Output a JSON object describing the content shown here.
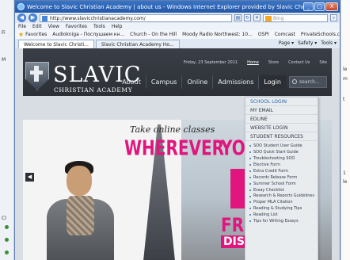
{
  "window": {
    "title": "Welcome to Slavic Christian Academy | about us - Windows Internet Explorer provided by Slavic Christian Academy",
    "min": "_",
    "max": "□",
    "close": "X"
  },
  "addressbar": {
    "url": "http://www.slavicchristianacademy.com/",
    "search_placeholder": "Bing"
  },
  "menubar": [
    "File",
    "Edit",
    "View",
    "Favorites",
    "Tools",
    "Help"
  ],
  "favorites": {
    "label": "Favorites",
    "items": [
      "Audiokniga - Послушаем кн...",
      "Church - On the Hill",
      "Moody Radio Northwest: 10...",
      "OSPI",
      "Comcast",
      "PrivateSchools.com"
    ]
  },
  "tabs": {
    "items": [
      "Welcome to Slavic Christi...",
      "Slavic Christian Academy Ho..."
    ],
    "tools": [
      "Page ▾",
      "Safety ▾",
      "Tools ▾"
    ]
  },
  "left_strip": {
    "labels": [
      "Fi",
      "M",
      "Cl"
    ]
  },
  "right_strip": {
    "labels": [
      "le",
      "m",
      "t",
      "1",
      "le"
    ]
  },
  "site": {
    "topline": {
      "date": "Friday, 23 September 2011",
      "links": [
        "Home",
        "Store",
        "Contact Us",
        "Site"
      ]
    },
    "logo": {
      "name": "SLAVIC",
      "sub": "CHRISTIAN ACADEMY"
    },
    "nav": [
      "About",
      "Campus",
      "Online",
      "Admissions",
      "Login"
    ],
    "search_placeholder": "search...",
    "hero": {
      "script": "Take online classes",
      "headline": "WHEREVER",
      "yo": "YO",
      "fr": "FR",
      "dis": "DIS"
    }
  },
  "dropdown": {
    "items": [
      "SCHOOL LOGIN",
      "MY EMAIL",
      "EDLINE",
      "WEBSITE LOGIN",
      "STUDENT RESOURCES"
    ],
    "subitems": [
      "SOO Student User Guide",
      "SOO Quick Start Guide",
      "Troubleshooting SOO",
      "Elective Form",
      "Extra Credit Form",
      "Records Release Form",
      "Summer School Form",
      "Essay Checklist",
      "Research & Reports Guidelines",
      "Proper MLA Citation",
      "Reading & Studying Tips",
      "Reading List",
      "Tips for Writing Essays"
    ]
  },
  "colors": {
    "accent": "#e0167e",
    "header": "#2c3036",
    "link": "#2a66b0"
  }
}
